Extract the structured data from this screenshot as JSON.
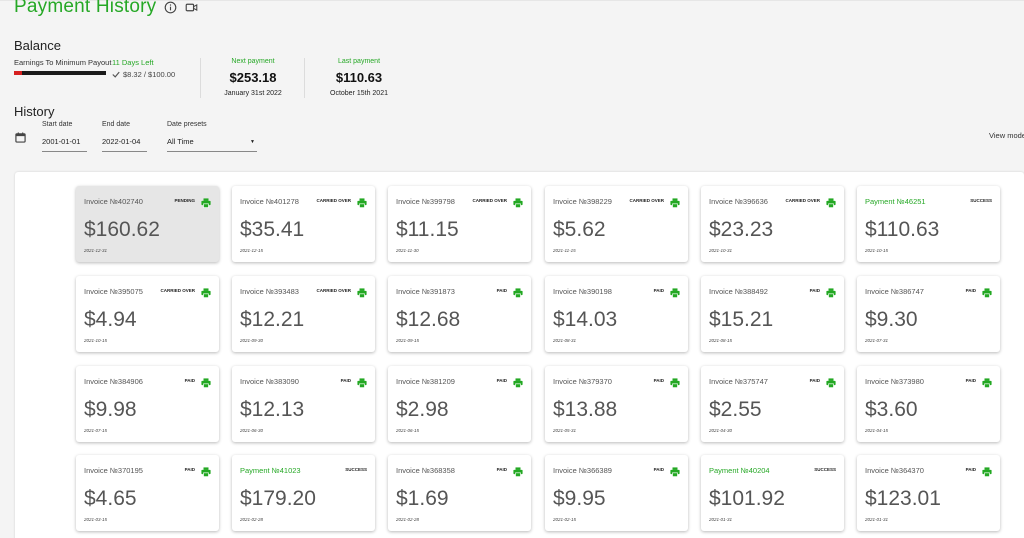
{
  "header": {
    "title": "Payment History"
  },
  "balance": {
    "heading": "Balance",
    "progress_label": "Earnings To Minimum Payout",
    "days_left": "11 Days Left",
    "progress_amount": "$8.32 / $100.00",
    "progress_fraction": 0.0832,
    "next_payment": {
      "label": "Next payment",
      "amount": "$253.18",
      "date": "January 31st 2022"
    },
    "last_payment": {
      "label": "Last payment",
      "amount": "$110.63",
      "date": "October 15th 2021"
    }
  },
  "history": {
    "heading": "History",
    "start_date": {
      "label": "Start date",
      "value": "2001-01-01"
    },
    "end_date": {
      "label": "End date",
      "value": "2022-01-04"
    },
    "presets": {
      "label": "Date presets",
      "value": "All Time"
    },
    "view_mode": "View mode"
  },
  "colors": {
    "accent": "#26a826",
    "progress_red": "#d62020"
  },
  "icons": {
    "info": "info-icon",
    "video": "video-icon",
    "calendar": "calendar-icon",
    "print": "print-icon",
    "check": "check-icon"
  },
  "cards": [
    {
      "title": "Invoice №402740",
      "status": "PENDING",
      "amount": "$160.62",
      "date": "2021-12-31",
      "kind": "invoice"
    },
    {
      "title": "Invoice №401278",
      "status": "CARRIED OVER",
      "amount": "$35.41",
      "date": "2021-12-15",
      "kind": "invoice"
    },
    {
      "title": "Invoice №399798",
      "status": "CARRIED OVER",
      "amount": "$11.15",
      "date": "2021-11-30",
      "kind": "invoice"
    },
    {
      "title": "Invoice №398229",
      "status": "CARRIED OVER",
      "amount": "$5.62",
      "date": "2021-11-15",
      "kind": "invoice"
    },
    {
      "title": "Invoice №396636",
      "status": "CARRIED OVER",
      "amount": "$23.23",
      "date": "2021-10-31",
      "kind": "invoice"
    },
    {
      "title": "Payment №46251",
      "status": "SUCCESS",
      "amount": "$110.63",
      "date": "2021-10-15",
      "kind": "payment"
    },
    {
      "title": "Invoice №395075",
      "status": "CARRIED OVER",
      "amount": "$4.94",
      "date": "2021-10-15",
      "kind": "invoice"
    },
    {
      "title": "Invoice №393483",
      "status": "CARRIED OVER",
      "amount": "$12.21",
      "date": "2021-09-30",
      "kind": "invoice"
    },
    {
      "title": "Invoice №391873",
      "status": "PAID",
      "amount": "$12.68",
      "date": "2021-09-15",
      "kind": "invoice"
    },
    {
      "title": "Invoice №390198",
      "status": "PAID",
      "amount": "$14.03",
      "date": "2021-08-31",
      "kind": "invoice"
    },
    {
      "title": "Invoice №388492",
      "status": "PAID",
      "amount": "$15.21",
      "date": "2021-08-15",
      "kind": "invoice"
    },
    {
      "title": "Invoice №386747",
      "status": "PAID",
      "amount": "$9.30",
      "date": "2021-07-31",
      "kind": "invoice"
    },
    {
      "title": "Invoice №384906",
      "status": "PAID",
      "amount": "$9.98",
      "date": "2021-07-15",
      "kind": "invoice"
    },
    {
      "title": "Invoice №383090",
      "status": "PAID",
      "amount": "$12.13",
      "date": "2021-06-30",
      "kind": "invoice"
    },
    {
      "title": "Invoice №381209",
      "status": "PAID",
      "amount": "$2.98",
      "date": "2021-06-15",
      "kind": "invoice"
    },
    {
      "title": "Invoice №379370",
      "status": "PAID",
      "amount": "$13.88",
      "date": "2021-05-31",
      "kind": "invoice"
    },
    {
      "title": "Invoice №375747",
      "status": "PAID",
      "amount": "$2.55",
      "date": "2021-04-30",
      "kind": "invoice"
    },
    {
      "title": "Invoice №373980",
      "status": "PAID",
      "amount": "$3.60",
      "date": "2021-04-15",
      "kind": "invoice"
    },
    {
      "title": "Invoice №370195",
      "status": "PAID",
      "amount": "$4.65",
      "date": "2021-03-15",
      "kind": "invoice"
    },
    {
      "title": "Payment №41023",
      "status": "SUCCESS",
      "amount": "$179.20",
      "date": "2021-02-28",
      "kind": "payment"
    },
    {
      "title": "Invoice №368358",
      "status": "PAID",
      "amount": "$1.69",
      "date": "2021-02-28",
      "kind": "invoice"
    },
    {
      "title": "Invoice №366389",
      "status": "PAID",
      "amount": "$9.95",
      "date": "2021-02-15",
      "kind": "invoice"
    },
    {
      "title": "Payment №40204",
      "status": "SUCCESS",
      "amount": "$101.92",
      "date": "2021-01-31",
      "kind": "payment"
    },
    {
      "title": "Invoice №364370",
      "status": "PAID",
      "amount": "$123.01",
      "date": "2021-01-31",
      "kind": "invoice"
    }
  ]
}
